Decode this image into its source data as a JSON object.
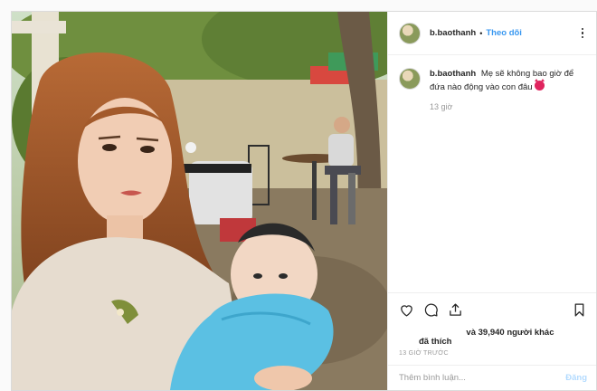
{
  "post": {
    "username": "b.baothanh",
    "follow_label": "Theo dõi",
    "caption": "Mẹ sẽ không bao giờ để đứa nào động vào con đâu",
    "caption_emoji_icon": "devil-face-icon",
    "relative_time": "13 giờ",
    "likes_prefix": "đã thích",
    "likes_suffix": "và 39,940 người khác",
    "timestamp": "13 GIỜ TRƯỚC",
    "comment_placeholder": "Thêm bình luận...",
    "post_label": "Đăng"
  },
  "colors": {
    "link": "#3897f0",
    "post_disabled": "#b3dbff",
    "border": "#dbdbdb"
  }
}
